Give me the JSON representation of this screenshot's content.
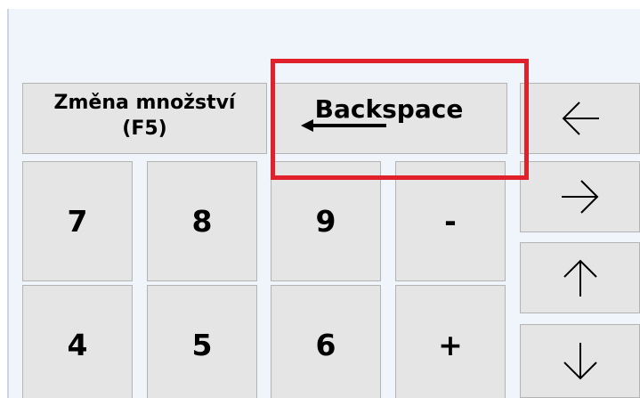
{
  "keypad": {
    "change_quantity_line1": "Změna množství",
    "change_quantity_line2": "(F5)",
    "backspace_label": "Backspace",
    "digits": {
      "seven": "7",
      "eight": "8",
      "nine": "9",
      "minus": "-",
      "four": "4",
      "five": "5",
      "six": "6",
      "plus": "+"
    },
    "arrows": [
      "arrow-left-icon",
      "arrow-right-icon",
      "arrow-up-icon",
      "arrow-down-icon"
    ]
  },
  "colors": {
    "key_background": "#e5e5e5",
    "key_border": "#b4b4b4",
    "panel_background": "#f0f5fb",
    "highlight": "#e0202b"
  }
}
